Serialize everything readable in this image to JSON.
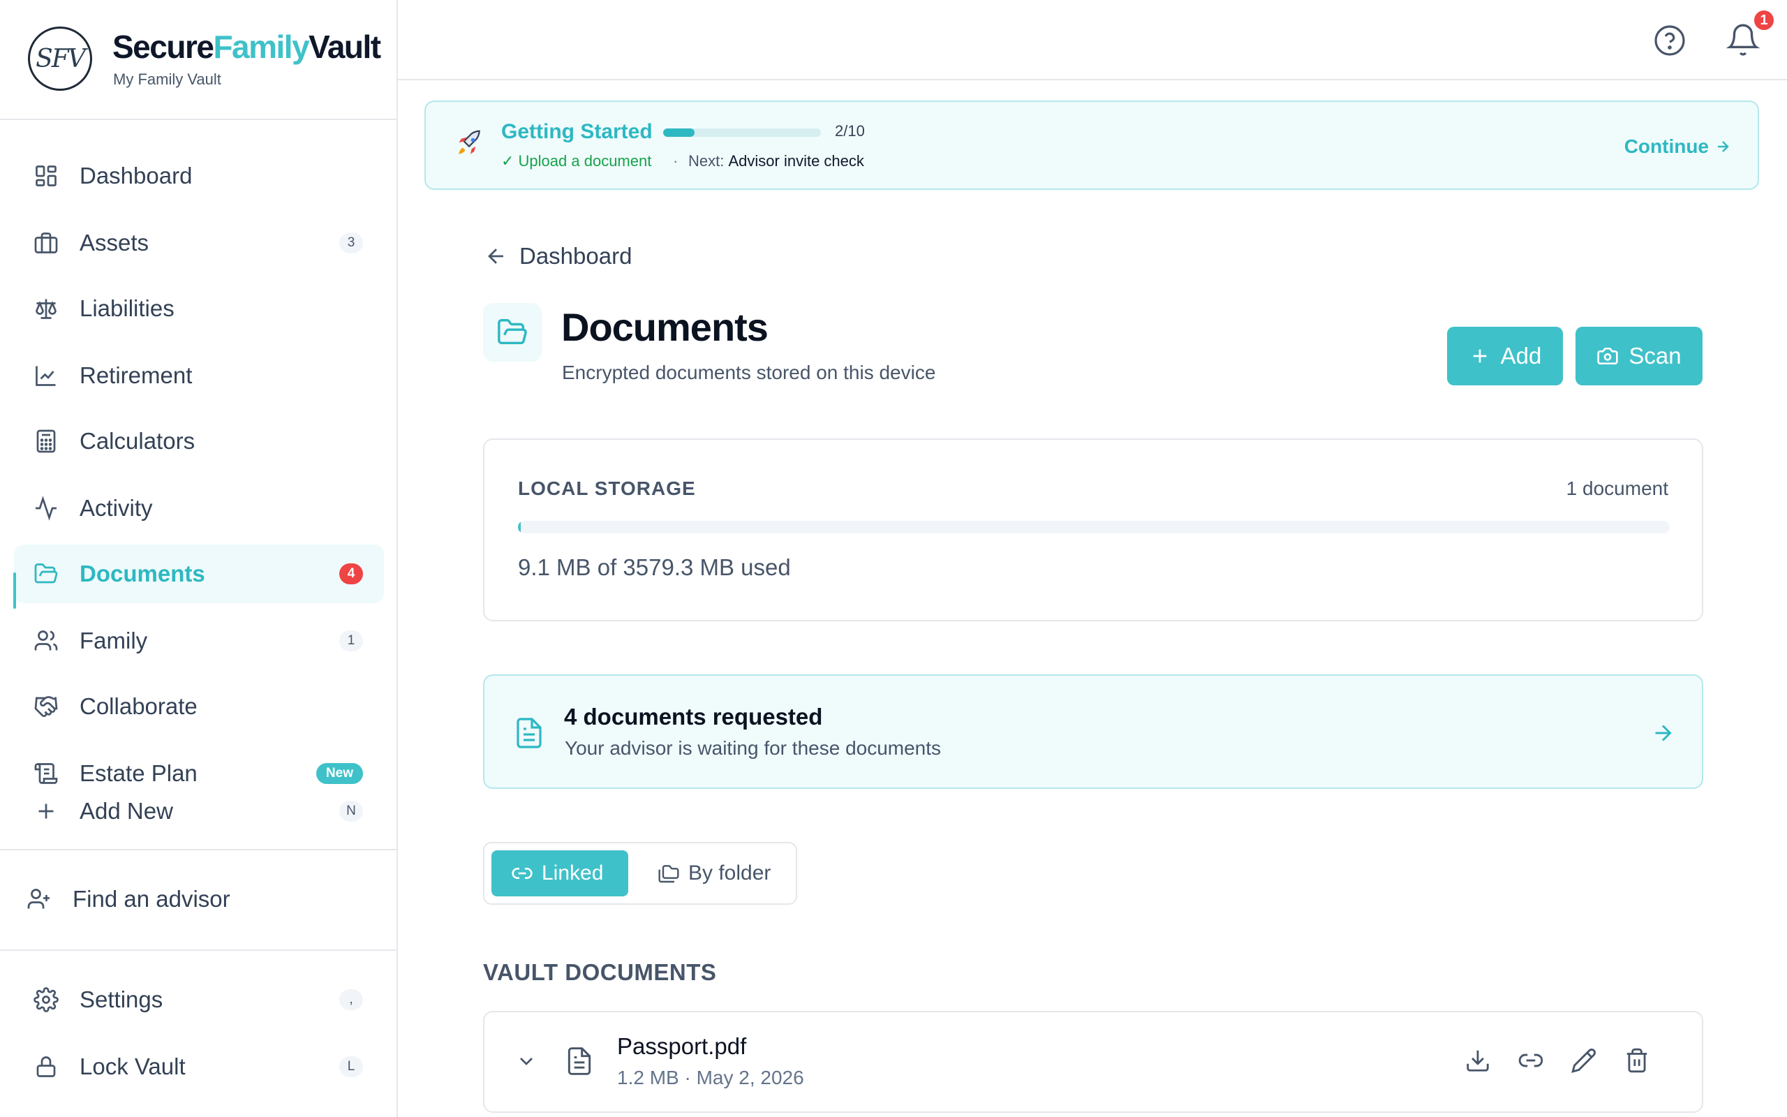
{
  "brand": {
    "logo_initials": "SFV",
    "name_part1": "Secure",
    "name_part2": "Family",
    "name_part3": "Vault",
    "subtitle": "My Family Vault"
  },
  "sidebar": {
    "items": [
      {
        "label": "Dashboard",
        "icon": "dashboard-icon"
      },
      {
        "label": "Assets",
        "icon": "briefcase-icon",
        "badge": "3"
      },
      {
        "label": "Liabilities",
        "icon": "scale-icon"
      },
      {
        "label": "Retirement",
        "icon": "chart-line-icon"
      },
      {
        "label": "Calculators",
        "icon": "calculator-icon"
      },
      {
        "label": "Activity",
        "icon": "activity-icon"
      },
      {
        "label": "Documents",
        "icon": "folder-open-icon",
        "badge": "4",
        "active": true
      },
      {
        "label": "Family",
        "icon": "users-icon",
        "badge": "1"
      },
      {
        "label": "Collaborate",
        "icon": "handshake-icon"
      },
      {
        "label": "Estate Plan",
        "icon": "scroll-icon",
        "badge": "New"
      },
      {
        "label": "Add New",
        "icon": "plus-icon",
        "badge": "N"
      }
    ],
    "find_advisor": "Find an advisor",
    "settings": {
      "label": "Settings",
      "shortcut": ","
    },
    "lock": {
      "label": "Lock Vault",
      "shortcut": "L"
    }
  },
  "topbar": {
    "help_icon": "help-circle-icon",
    "bell_icon": "bell-icon",
    "notification_count": "1"
  },
  "getting_started": {
    "title": "Getting Started",
    "progress": 0.2,
    "count": "2/10",
    "done": "✓ Upload a document",
    "separator": "·",
    "next_label": "Next:",
    "next_item": "Advisor invite check",
    "continue": "Continue"
  },
  "breadcrumb": {
    "back_label": "Dashboard"
  },
  "page": {
    "title": "Documents",
    "subtitle": "Encrypted documents stored on this device",
    "add_label": "Add",
    "scan_label": "Scan"
  },
  "storage": {
    "label": "LOCAL STORAGE",
    "count": "1 document",
    "used_fraction": 0.0025,
    "used_text": "9.1 MB of 3579.3 MB used"
  },
  "request": {
    "title": "4 documents requested",
    "subtitle": "Your advisor is waiting for these documents"
  },
  "view_toggle": {
    "linked": "Linked",
    "by_folder": "By folder",
    "selected": "Linked"
  },
  "vault": {
    "title": "VAULT DOCUMENTS",
    "documents": [
      {
        "name": "Passport.pdf",
        "meta": "1.2 MB · May 2, 2026"
      }
    ]
  },
  "colors": {
    "accent": "#3fc1c9",
    "accent_text": "#2db8c2",
    "danger": "#ef4444",
    "success": "#16a34a"
  }
}
